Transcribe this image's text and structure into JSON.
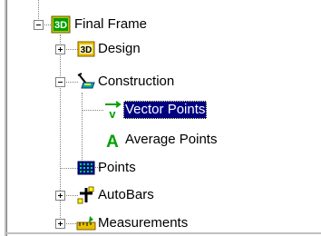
{
  "tree": {
    "root": {
      "label": "Final Frame",
      "icon": "3d-frame-icon",
      "expanded": true
    },
    "children": [
      {
        "label": "Design",
        "icon": "3d-design-icon",
        "expanded": false
      },
      {
        "label": "Construction",
        "icon": "construction-icon",
        "expanded": true,
        "children": [
          {
            "label": "Vector Points",
            "icon": "vector-points-icon",
            "selected": true
          },
          {
            "label": "Average Points",
            "icon": "average-points-icon"
          }
        ]
      },
      {
        "label": "Points",
        "icon": "points-grid-icon"
      },
      {
        "label": "AutoBars",
        "icon": "autobars-icon",
        "expanded": false
      },
      {
        "label": "Measurements",
        "icon": "measurements-icon",
        "expanded": false
      }
    ]
  },
  "colors": {
    "selection": "#000080",
    "selection_text": "#ffffff",
    "icon_green": "#00a000",
    "icon_yellow": "#ffff00"
  }
}
